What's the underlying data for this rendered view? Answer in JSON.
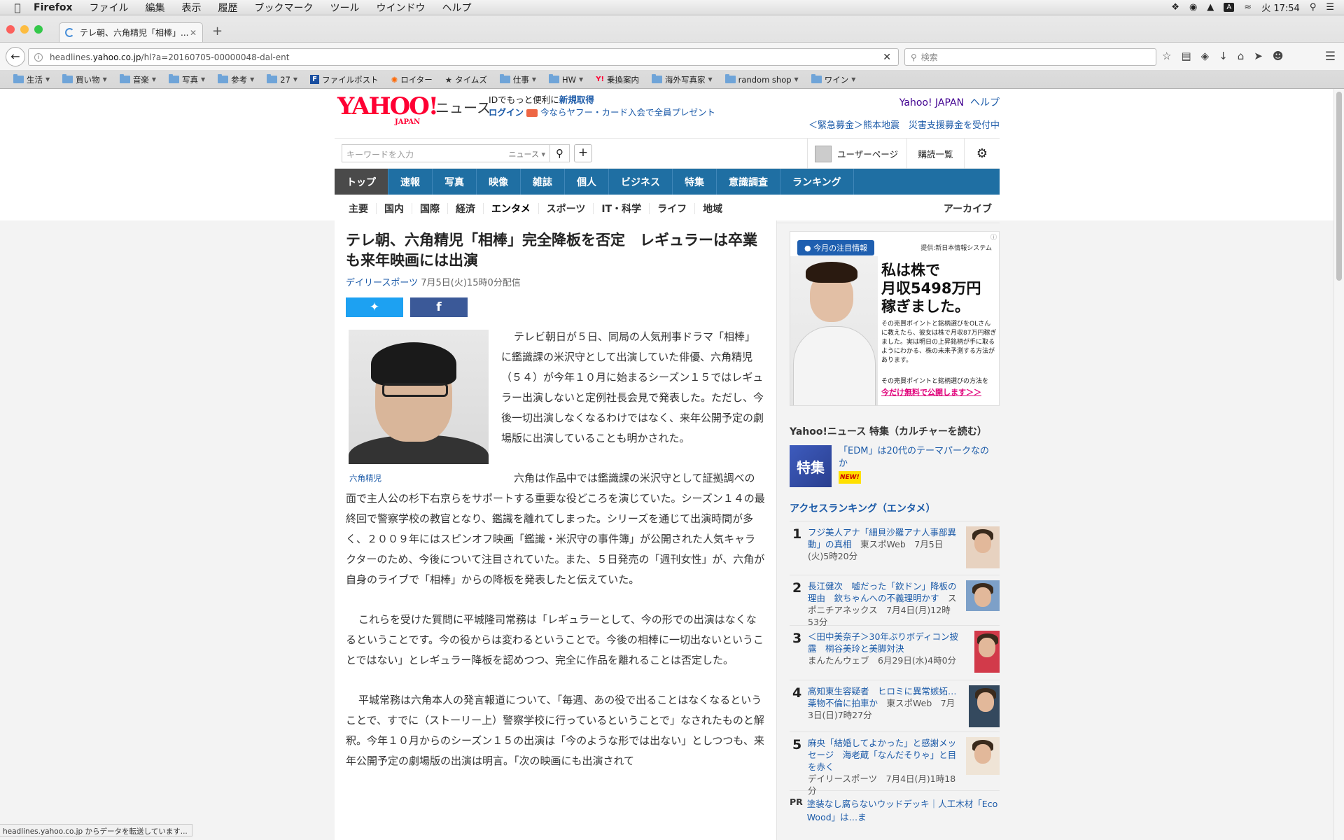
{
  "menubar": {
    "app": "Firefox",
    "items": [
      "ファイル",
      "編集",
      "表示",
      "履歴",
      "ブックマーク",
      "ツール",
      "ウインドウ",
      "ヘルプ"
    ],
    "clock": "火 17:54",
    "a_icon": "A"
  },
  "browser": {
    "tab_title": "テレ朝、六角精児「相棒」...",
    "url_prefix": "headlines.",
    "url_domain": "yahoo.co.jp",
    "url_rest": "/hl?a=20160705-00000048-dal-ent",
    "search_placeholder": "検索",
    "bookmarks": [
      {
        "label": "生活",
        "icon": "folder",
        "caret": true
      },
      {
        "label": "買い物",
        "icon": "folder",
        "caret": true
      },
      {
        "label": "音楽",
        "icon": "folder",
        "caret": true
      },
      {
        "label": "写真",
        "icon": "folder",
        "caret": true
      },
      {
        "label": "参考",
        "icon": "folder",
        "caret": true
      },
      {
        "label": "27",
        "icon": "folder",
        "caret": true
      },
      {
        "label": "ファイルポスト",
        "icon": "F",
        "caret": false
      },
      {
        "label": "ロイター",
        "icon": "reuters",
        "caret": false
      },
      {
        "label": "タイムズ",
        "icon": "times",
        "caret": false
      },
      {
        "label": "仕事",
        "icon": "folder",
        "caret": true
      },
      {
        "label": "HW",
        "icon": "folder",
        "caret": true
      },
      {
        "label": "乗換案内",
        "icon": "Y!",
        "caret": false
      },
      {
        "label": "海外写真家",
        "icon": "folder",
        "caret": true
      },
      {
        "label": "random shop",
        "icon": "folder",
        "caret": true
      },
      {
        "label": "ワイン",
        "icon": "folder",
        "caret": true
      }
    ],
    "status_text": "headlines.yahoo.co.jp からデータを転送しています..."
  },
  "header": {
    "logo": "YAHOO!",
    "logo_sub": "JAPAN",
    "section": "ニュース",
    "id_text": "IDでもっと便利に",
    "register": "新規取得",
    "login": "ログイン",
    "promo": "今ならヤフー・カード入会で全員プレゼント",
    "yj": "Yahoo! JAPAN",
    "help": "ヘルプ",
    "urgent": "＜緊急募金＞熊本地震　災害支援募金を受付中"
  },
  "searchbar": {
    "placeholder": "キーワードを入力",
    "scope": "ニュース",
    "user_page": "ユーザーページ",
    "subscriptions": "購読一覧"
  },
  "global_nav": [
    "トップ",
    "速報",
    "写真",
    "映像",
    "雑誌",
    "個人",
    "ビジネス",
    "特集",
    "意識調査",
    "ランキング"
  ],
  "category_nav": [
    "主要",
    "国内",
    "国際",
    "経済",
    "エンタメ",
    "スポーツ",
    "IT・科学",
    "ライフ",
    "地域"
  ],
  "archive": "アーカイブ",
  "article": {
    "title": "テレ朝、六角精児「相棒」完全降板を否定　レギュラーは卒業も来年映画には出演",
    "source": "デイリースポーツ",
    "date": "7月5日(火)15時0分配信",
    "photo_caption": "六角精児",
    "paragraphs": [
      "テレビ朝日が５日、同局の人気刑事ドラマ「相棒」に鑑識課の米沢守として出演していた俳優、六角精児（５４）が今年１０月に始まるシーズン１５ではレギュラー出演しないと定例社長会見で発表した。ただし、今後一切出演しなくなるわけではなく、来年公開予定の劇場版に出演していることも明かされた。",
      "六角は作品中では鑑識課の米沢守として証拠調べの面で主人公の杉下右京らをサポートする重要な役どころを演じていた。シーズン１４の最終回で警察学校の教官となり、鑑識を離れてしまった。シリーズを通じて出演時間が多く、２００９年にはスピンオフ映画「鑑識・米沢守の事件簿」が公開された人気キャラクターのため、今後について注目されていた。また、５日発売の「週刊女性」が、六角が自身のライブで「相棒」からの降板を発表したと伝えていた。",
      "これらを受けた質問に平城隆司常務は「レギュラーとして、今の形での出演はなくなるということです。今の役からは変わるということで。今後の相棒に一切出ないということではない」とレギュラー降板を認めつつ、完全に作品を離れることは否定した。",
      "平城常務は六角本人の発言報道について、「毎週、あの役で出ることはなくなるということで、すでに（ストーリー上）警察学校に行っているということで」なされたものと解釈。今年１０月からのシーズン１５の出演は「今のような形では出ない」としつつも、来年公開予定の劇場版の出演は明言。「次の映画にも出演されて"
    ]
  },
  "ad": {
    "badge": "今月の注目情報",
    "provider": "提供:新日本情報システム",
    "headline": [
      "私は株で",
      "月収5498万円",
      "稼ぎました。"
    ],
    "body": "その売買ポイントと銘柄選びをOLさんに教えたら、彼女は株で月収87万円稼ぎました。実は明日の上昇銘柄が手に取るようにわかる、株の未来予測する方法があります。",
    "body2": "その売買ポイントと銘柄選びの方法を",
    "link": "今だけ無料で公開します＞＞"
  },
  "feature": {
    "heading": "Yahoo!ニュース 特集（カルチャーを読む）",
    "thumb": "特集",
    "title": "「EDM」は20代のテーマパークなのか",
    "new": "NEW!"
  },
  "ranking": {
    "heading": "アクセスランキング（エンタメ）",
    "items": [
      {
        "rank": "1",
        "title": "フジ美人アナ「細貝沙羅アナ人事部異動」の真相",
        "source": "東スポWeb　7月5日(火)5時20分"
      },
      {
        "rank": "2",
        "title": "長江健次　嘘だった「欽ドン」降板の理由　欽ちゃんへの不義理明かす",
        "source": "スポニチアネックス　7月4日(月)12時53分"
      },
      {
        "rank": "3",
        "title": "＜田中美奈子＞30年ぶりボディコン披露　桐谷美玲と美脚対決",
        "source": "まんたんウェブ　6月29日(水)4時0分"
      },
      {
        "rank": "4",
        "title": "高知東生容疑者　ヒロミに異常嫉妬…薬物不倫に拍車か",
        "source": "東スポWeb　7月3日(日)7時27分"
      },
      {
        "rank": "5",
        "title": "麻央「結婚してよかった」と感謝メッセージ　海老蔵「なんだそりゃ」と目を赤く",
        "source": "デイリースポーツ　7月4日(月)1時18分"
      }
    ],
    "pr_label": "PR",
    "pr_text": "塗装なし腐らないウッドデッキ｜人工木材「Eco Wood」は…ま"
  },
  "colors": {
    "nav_blue": "#1f6fa3",
    "link_blue": "#1b5aa8",
    "yahoo_red": "#ff0033",
    "twitter": "#1da1f2",
    "facebook": "#3b5998"
  }
}
